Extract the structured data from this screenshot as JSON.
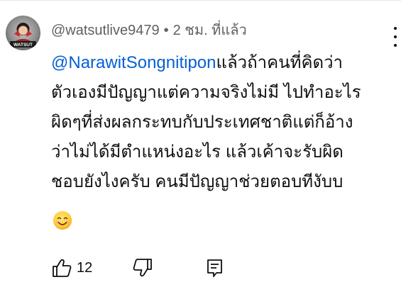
{
  "comment": {
    "author_handle": "@watsutlive9479",
    "separator": "•",
    "timestamp": "2 ชม. ที่แล้ว",
    "avatar_badge": "WATSUT",
    "mention": "@NarawitSongnitipon",
    "text_lines": [
      "แล้วถ้าคนที่คิดว่า",
      "ตัวเองมีปัญญาแต่ความจริงไม่มี ไปทำอะไร",
      "ผิดๆที่ส่งผลกระทบกับประเทศชาติแต่ก็อ้าง",
      "ว่าไม่ได้มีตำแหน่งอะไร แล้วเค้าจะรับผิด",
      "ชอบยังไงครับ คนมีปัญญาช่วยตอบทีงับบ"
    ],
    "emoji": "smiling-face-with-smiling-eyes",
    "like_count": "12",
    "icons": {
      "like": "thumbs-up-icon",
      "dislike": "thumbs-down-icon",
      "reply": "reply-icon",
      "menu": "more-vertical-icon"
    },
    "colors": {
      "mention": "#065fd4",
      "meta": "#606060",
      "text": "#0f0f0f"
    }
  }
}
